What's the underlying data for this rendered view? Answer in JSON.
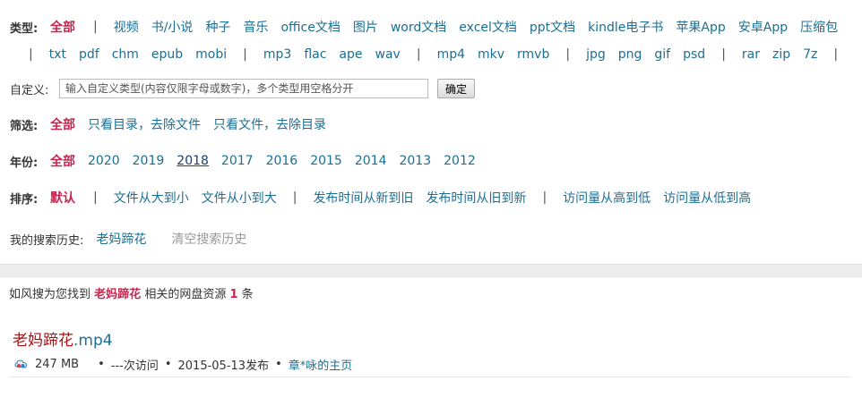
{
  "filters": {
    "type_label": "类型:",
    "type_row1": [
      "全部",
      "|",
      "视频",
      "书/小说",
      "种子",
      "音乐",
      "office文档",
      "图片",
      "word文档",
      "excel文档",
      "ppt文档",
      "kindle电子书",
      "苹果App",
      "安卓App",
      "压缩包"
    ],
    "type_row2": [
      "|",
      "txt",
      "pdf",
      "chm",
      "epub",
      "mobi",
      "|",
      "mp3",
      "flac",
      "ape",
      "wav",
      "|",
      "mp4",
      "mkv",
      "rmvb",
      "|",
      "jpg",
      "png",
      "gif",
      "psd",
      "|",
      "rar",
      "zip",
      "7z",
      "|"
    ],
    "custom_label": "自定义:",
    "custom_placeholder": "输入自定义类型(内容仅限字母或数字)，多个类型用空格分开",
    "custom_button": "确定",
    "screen_label": "筛选:",
    "screen_items": [
      "全部",
      "只看目录，去除文件",
      "只看文件，去除目录"
    ],
    "year_label": "年份:",
    "year_items": [
      "全部",
      "2020",
      "2019",
      "2018",
      "2017",
      "2016",
      "2015",
      "2014",
      "2013",
      "2012"
    ],
    "sort_label": "排序:",
    "sort_items": [
      "默认",
      "|",
      "文件从大到小",
      "文件从小到大",
      "|",
      "发布时间从新到旧",
      "发布时间从旧到新",
      "|",
      "访问量从高到低",
      "访问量从低到高"
    ],
    "history_label": "我的搜索历史:",
    "history_item": "老妈蹄花",
    "history_clear": "清空搜索历史"
  },
  "results": {
    "summary_prefix": "如风搜为您找到",
    "keyword": "老妈蹄花",
    "summary_middle": "相关的网盘资源",
    "count": "1",
    "summary_suffix": "条",
    "items": [
      {
        "title_highlight": "老妈蹄花",
        "title_ext": ".mp4",
        "size": "247 MB",
        "visits": "---次访问",
        "published": "2015-05-13发布",
        "owner": "章*咏的主页",
        "dot": "•"
      }
    ]
  },
  "colors": {
    "active": "#c7254e",
    "link": "#1a6f94",
    "keyword": "#a31515"
  }
}
